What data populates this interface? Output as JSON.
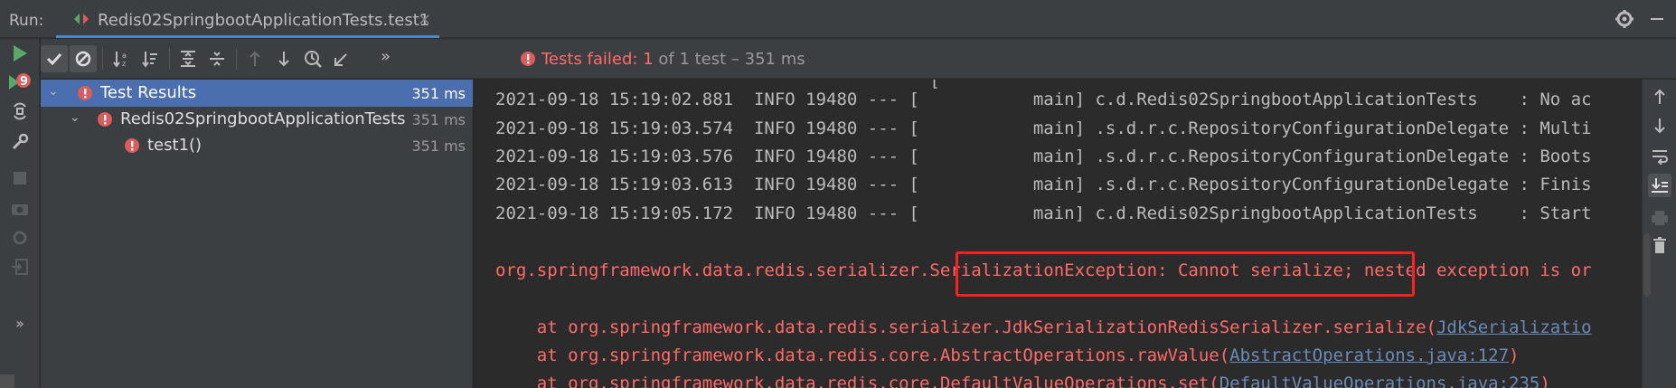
{
  "run_label": "Run:",
  "tab": {
    "title": "Redis02SpringbootApplicationTests.test1",
    "close": "×"
  },
  "toolbar": {
    "status_failed": "Tests failed: 1",
    "status_rest": " of 1 test – 351 ms",
    "more": "»"
  },
  "tree": [
    {
      "label": "Test Results",
      "time": "351 ms",
      "selected": true
    },
    {
      "label": "Redis02SpringbootApplicationTests",
      "time": "351 ms"
    },
    {
      "label": "test1()",
      "time": "351 ms"
    }
  ],
  "left_more": "»",
  "console": {
    "lines": [
      "2021-09-18 15:19:02.881  INFO 19480 --- [           main] c.d.Redis02SpringbootApplicationTests    : No ac",
      "2021-09-18 15:19:03.574  INFO 19480 --- [           main] .s.d.r.c.RepositoryConfigurationDelegate : Multi",
      "2021-09-18 15:19:03.576  INFO 19480 --- [           main] .s.d.r.c.RepositoryConfigurationDelegate : Boots",
      "2021-09-18 15:19:03.613  INFO 19480 --- [           main] .s.d.r.c.RepositoryConfigurationDelegate : Finis",
      "2021-09-18 15:19:05.172  INFO 19480 --- [           main] c.d.Redis02SpringbootApplicationTests    : Start"
    ],
    "exception": "org.springframework.data.redis.serializer.SerializationException: Cannot serialize; nested exception is or",
    "stack": [
      {
        "prefix": "    at org.springframework.data.redis.serializer.JdkSerializationRedisSerializer.serialize(",
        "link": "JdkSerializatio",
        "suffix": ""
      },
      {
        "prefix": "    at org.springframework.data.redis.core.AbstractOperations.rawValue(",
        "link": "AbstractOperations.java:127",
        "suffix": ")"
      },
      {
        "prefix": "    at org.springframework.data.redis.core.DefaultValueOperations.set(",
        "link": "DefaultValueOperations.java:235",
        "suffix": ")"
      }
    ]
  },
  "colors": {
    "error": "#ff6b68",
    "selection": "#4b6eaf",
    "run_green": "#59a869",
    "highlight_box": "#ff2020"
  }
}
